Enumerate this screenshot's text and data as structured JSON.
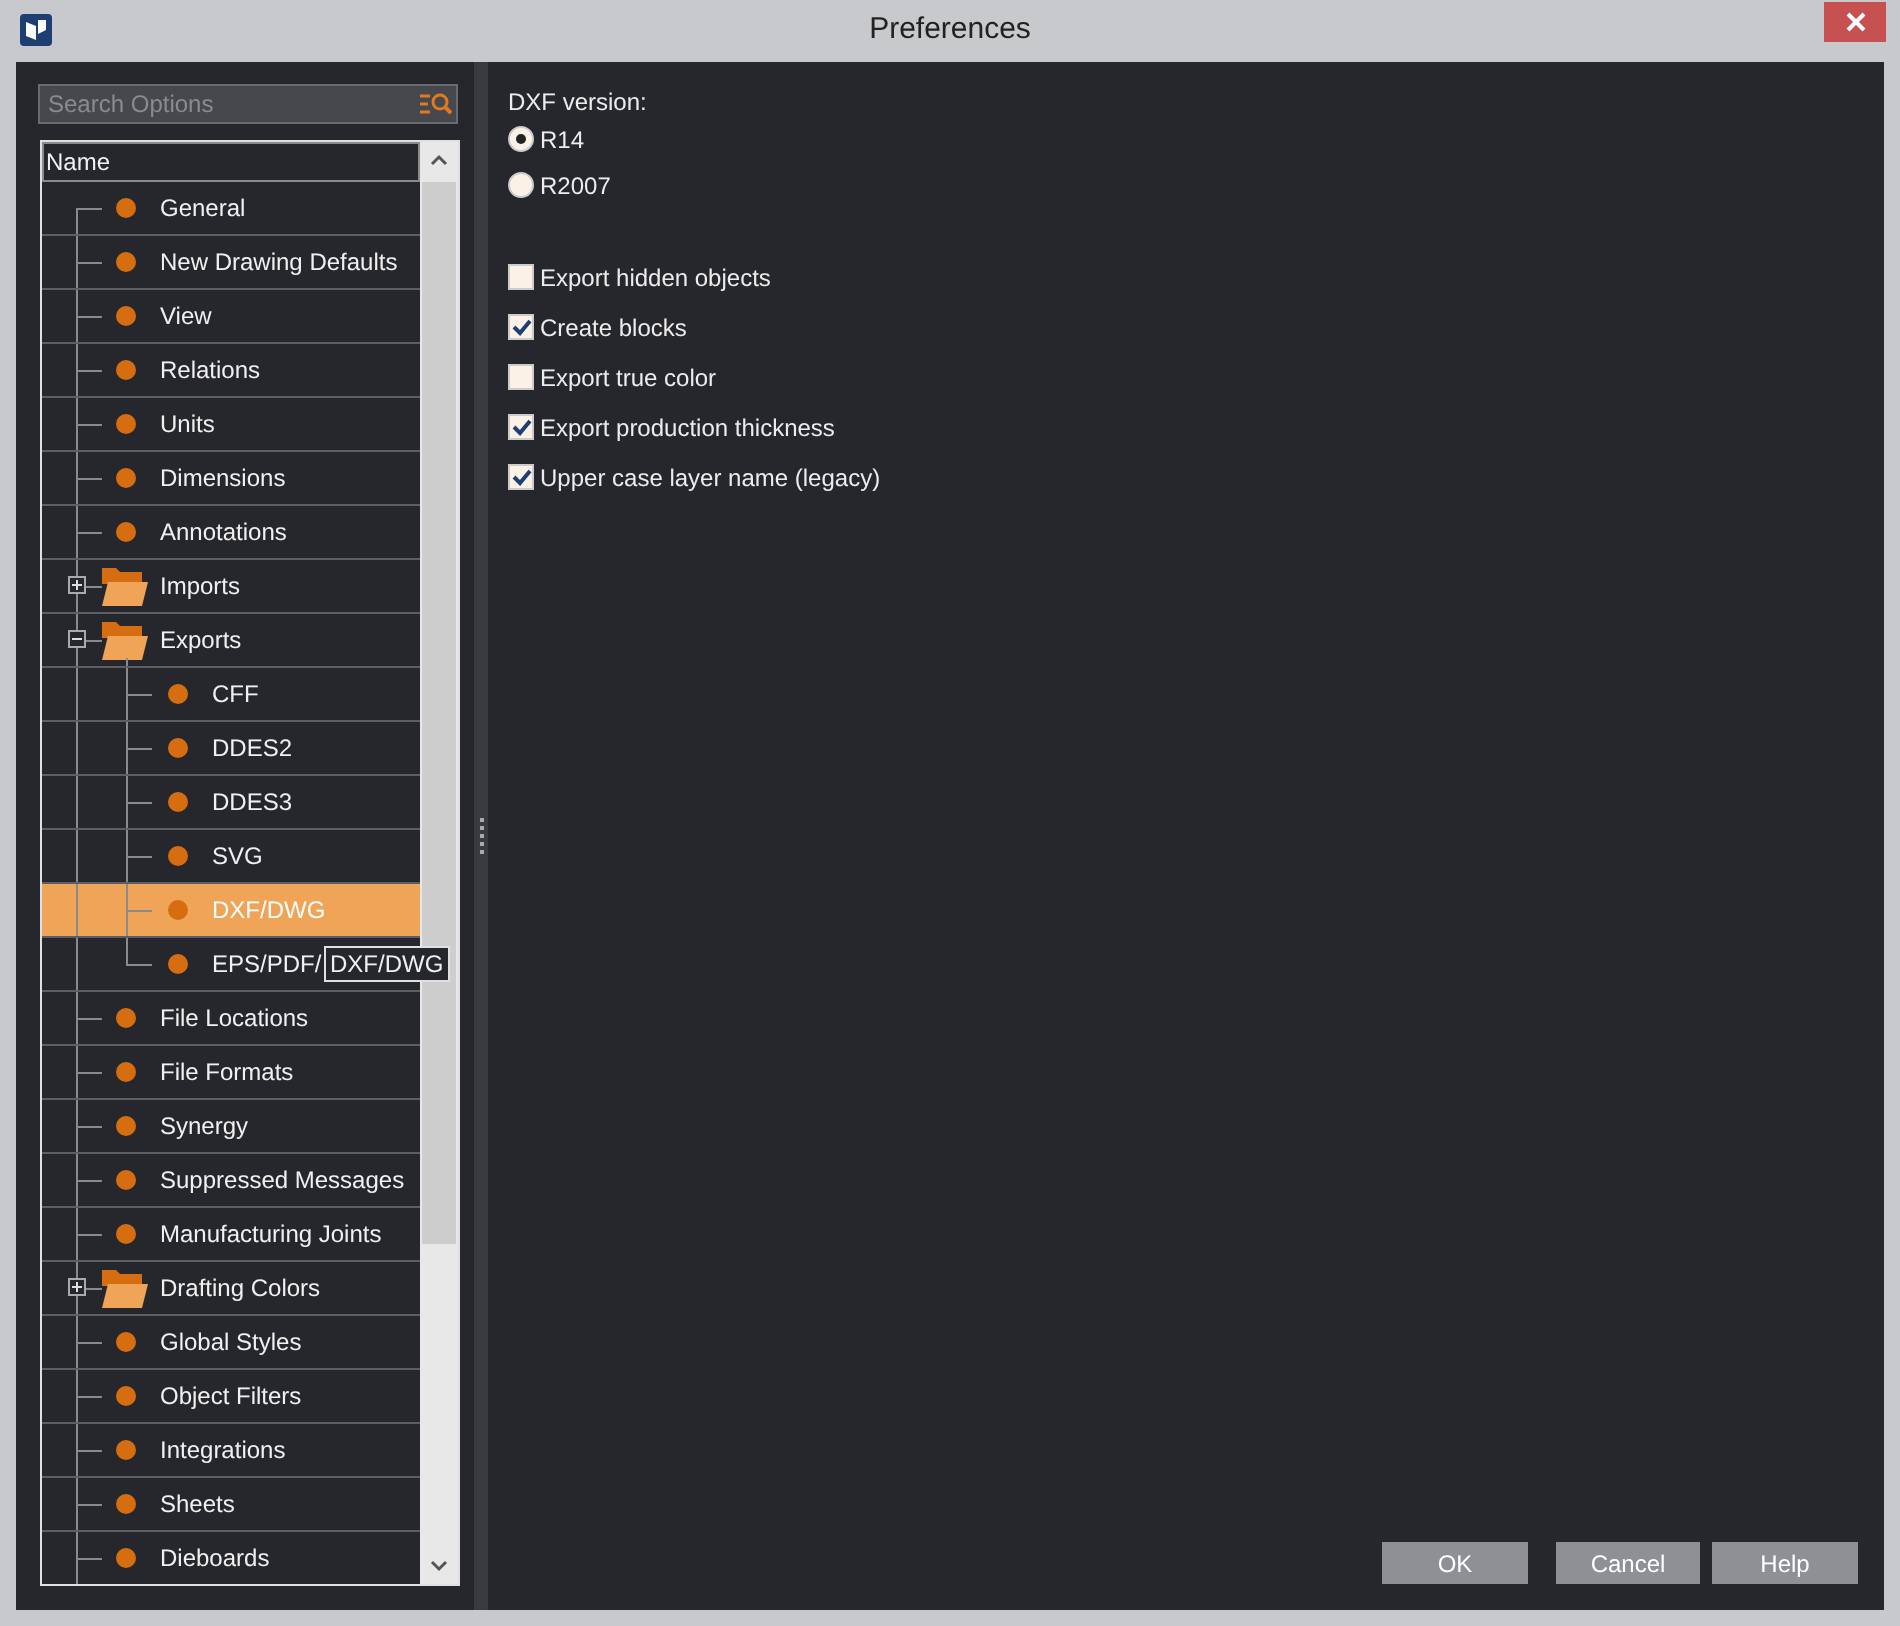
{
  "window": {
    "title": "Preferences"
  },
  "search": {
    "placeholder": "Search Options"
  },
  "tree": {
    "column": "Name",
    "items": [
      {
        "kind": "leaf",
        "label": "General",
        "selected": false
      },
      {
        "kind": "leaf",
        "label": "New Drawing Defaults",
        "selected": false
      },
      {
        "kind": "leaf",
        "label": "View",
        "selected": false
      },
      {
        "kind": "leaf",
        "label": "Relations",
        "selected": false
      },
      {
        "kind": "leaf",
        "label": "Units",
        "selected": false
      },
      {
        "kind": "leaf",
        "label": "Dimensions",
        "selected": false
      },
      {
        "kind": "leaf",
        "label": "Annotations",
        "selected": false
      },
      {
        "kind": "folder",
        "label": "Imports",
        "selected": false,
        "expanded": false
      },
      {
        "kind": "folder",
        "label": "Exports",
        "selected": false,
        "expanded": true,
        "children": [
          {
            "kind": "leaf",
            "label": "CFF",
            "selected": false
          },
          {
            "kind": "leaf",
            "label": "DDES2",
            "selected": false
          },
          {
            "kind": "leaf",
            "label": "DDES3",
            "selected": false
          },
          {
            "kind": "leaf",
            "label": "SVG",
            "selected": false
          },
          {
            "kind": "leaf",
            "label": "DXF/DWG",
            "selected": true
          },
          {
            "kind": "leaf",
            "label": "EPS/PDF/",
            "selected": false
          }
        ]
      },
      {
        "kind": "leaf",
        "label": "File Locations",
        "selected": false
      },
      {
        "kind": "leaf",
        "label": "File Formats",
        "selected": false
      },
      {
        "kind": "leaf",
        "label": "Synergy",
        "selected": false
      },
      {
        "kind": "leaf",
        "label": "Suppressed Messages",
        "selected": false
      },
      {
        "kind": "leaf",
        "label": "Manufacturing Joints",
        "selected": false
      },
      {
        "kind": "folder",
        "label": "Drafting Colors",
        "selected": false,
        "expanded": false
      },
      {
        "kind": "leaf",
        "label": "Global Styles",
        "selected": false
      },
      {
        "kind": "leaf",
        "label": "Object Filters",
        "selected": false
      },
      {
        "kind": "leaf",
        "label": "Integrations",
        "selected": false
      },
      {
        "kind": "leaf",
        "label": "Sheets",
        "selected": false
      },
      {
        "kind": "leaf",
        "label": "Dieboards",
        "selected": false
      }
    ]
  },
  "tooltip": "DXF/DWG",
  "dxf_version": {
    "label": "DXF version:",
    "options": [
      {
        "label": "R14",
        "selected": true
      },
      {
        "label": "R2007",
        "selected": false
      }
    ]
  },
  "options": [
    {
      "label": "Export hidden objects",
      "checked": false
    },
    {
      "label": "Create blocks",
      "checked": true
    },
    {
      "label": "Export true color",
      "checked": false
    },
    {
      "label": "Export production thickness",
      "checked": true
    },
    {
      "label": "Upper case layer name (legacy)",
      "checked": true
    }
  ],
  "buttons": [
    "OK",
    "Cancel",
    "Help"
  ]
}
